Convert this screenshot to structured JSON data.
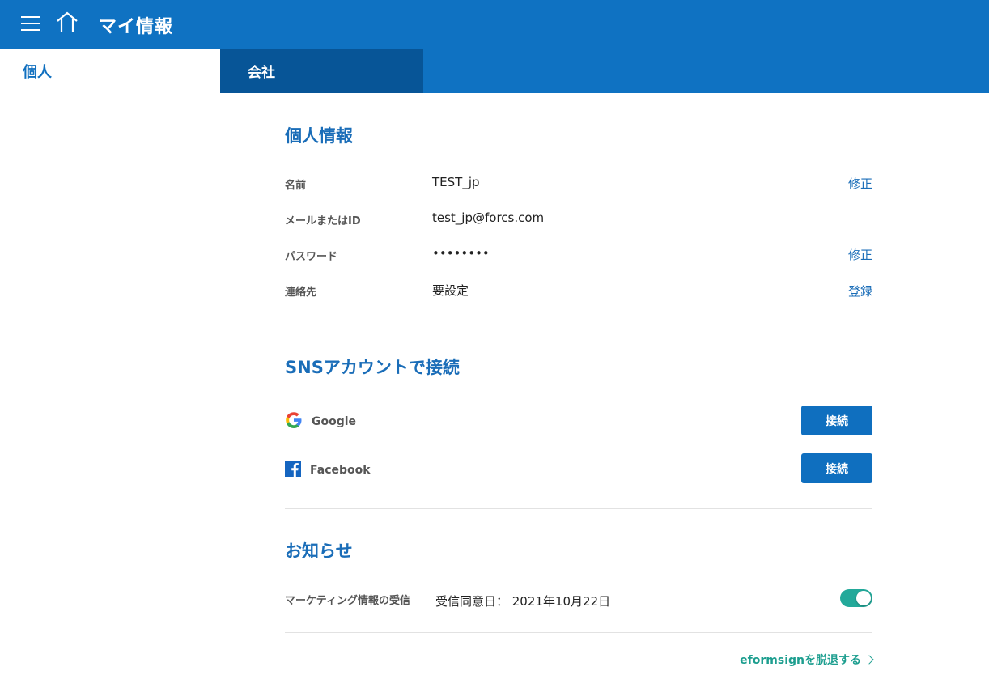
{
  "header": {
    "title": "マイ情報",
    "menu_icon": "hamburger-menu-icon",
    "home_icon": "home-icon",
    "color": "#0f72c2"
  },
  "tabs": [
    {
      "label": "個人",
      "active": true
    },
    {
      "label": "会社",
      "active": false
    }
  ],
  "personal_info": {
    "title": "個人情報",
    "rows": [
      {
        "label": "名前",
        "value": "TEST_jp",
        "action": "修正"
      },
      {
        "label": "メールまたはID",
        "value": "test_jp@forcs.com",
        "action": ""
      },
      {
        "label": "パスワード",
        "value": "••••••••",
        "action": "修正"
      },
      {
        "label": "連絡先",
        "value": "要設定",
        "action": "登録"
      }
    ]
  },
  "sns": {
    "title": "SNSアカウントで接続",
    "accounts": [
      {
        "name": "Google",
        "icon": "google-icon",
        "button": "接続"
      },
      {
        "name": "Facebook",
        "icon": "facebook-icon",
        "button": "接続"
      }
    ]
  },
  "notifications": {
    "title": "お知らせ",
    "marketing_label": "マーケティング情報の受信",
    "consent_text": "受信同意日： 2021年10月22日",
    "enabled": true,
    "toggle_color": "#23a99a"
  },
  "leave_link": "eformsignを脱退する"
}
